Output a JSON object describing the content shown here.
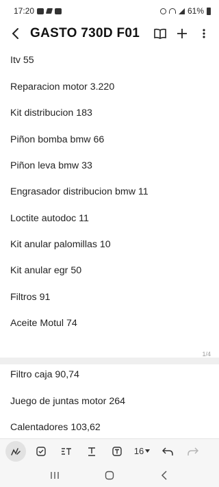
{
  "status_bar": {
    "time": "17:20",
    "battery": "61%"
  },
  "app_bar": {
    "title": "GASTO 730D F01",
    "icons": [
      "back-arrow-icon",
      "book-icon",
      "plus-icon",
      "more-vert-icon"
    ]
  },
  "note": {
    "page1_lines": [
      "Itv 55",
      "Reparacion motor 3.220",
      "Kit distribucion 183",
      "Piñon bomba bmw 66",
      "Piñon leva bmw 33",
      "Engrasador distribucion bmw 11",
      "Loctite autodoc 11",
      "Kit anular palomillas 10",
      "Kit anular egr 50",
      "Filtros 91",
      "Aceite Motul 74"
    ],
    "page_indicator": "1/4",
    "page2_lines": [
      "Filtro caja 90,74",
      "Juego de juntas motor 264",
      "Calentadores 103,62"
    ]
  },
  "toolbar": {
    "font_size": "16",
    "icons": [
      "pen-icon",
      "checkbox-icon",
      "text-style-icon",
      "underline-icon",
      "text-box-icon",
      "undo-icon",
      "redo-icon"
    ]
  },
  "nav_bar": {
    "icons": [
      "recents-icon",
      "home-icon",
      "back-icon"
    ]
  }
}
